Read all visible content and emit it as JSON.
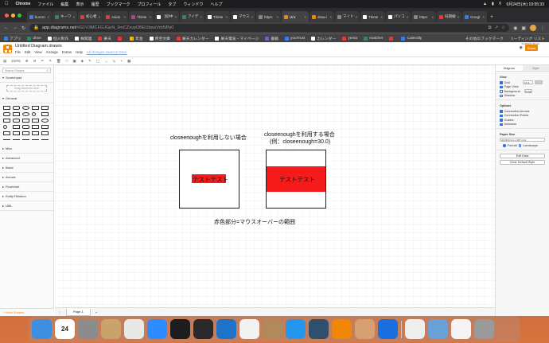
{
  "menubar": {
    "app": "Chrome",
    "items": [
      "ファイル",
      "編集",
      "表示",
      "履歴",
      "ブックマーク",
      "プロフィール",
      "タブ",
      "ウィンドウ",
      "ヘルプ"
    ],
    "datetime": "6月24日(木) 19:55:33"
  },
  "tabs": [
    {
      "label": "kuroro",
      "color": "#3b7de8"
    },
    {
      "label": "キーワ",
      "color": "#2e8b57"
    },
    {
      "label": "初心者",
      "color": "#e53935"
    },
    {
      "label": "Asian",
      "color": "#e53935"
    },
    {
      "label": "Tkinte",
      "color": "#b0438c"
    },
    {
      "label": "【初中",
      "color": "#ffffff"
    },
    {
      "label": "アイデ",
      "color": "#2e8b57"
    },
    {
      "label": "Tkinte",
      "color": "#ffffff"
    },
    {
      "label": "マウス",
      "color": "#ffffff"
    },
    {
      "label": "https:",
      "color": "#888888"
    },
    {
      "label": "Unt",
      "color": "#f08705",
      "active": true
    },
    {
      "label": "draw.i",
      "color": "#f08705"
    },
    {
      "label": "マイド",
      "color": "#888888"
    },
    {
      "label": "Tkinte",
      "color": "#ffffff"
    },
    {
      "label": "パソコ",
      "color": "#ffffff"
    },
    {
      "label": "https:",
      "color": "#888888"
    },
    {
      "label": "同期検",
      "color": "#e53935"
    },
    {
      "label": "Googl",
      "color": "#3b7de8"
    }
  ],
  "address": {
    "url": "app.diagrams.net",
    "url_rest": "/#G1V3MCFGJGpN_9mCZxvpOBEUbwsVrbNPp0"
  },
  "bookmarks": {
    "items": [
      {
        "label": "アプリ",
        "color": "#3b7de8"
      },
      {
        "label": "drive",
        "color": "#2e8b57"
      },
      {
        "label": "個人制作",
        "color": "#ffffff"
      },
      {
        "label": "株関連",
        "color": "#ffffff"
      },
      {
        "label": "楽天",
        "color": "#e53935"
      },
      {
        "label": "",
        "color": "#e53935"
      },
      {
        "label": "年金",
        "color": "#f4b400"
      },
      {
        "label": "青空文庫",
        "color": "#ffffff"
      },
      {
        "label": "楽天カレンダー",
        "color": "#e53935"
      },
      {
        "label": "楽天電気・マイページ",
        "color": "#ffffff"
      },
      {
        "label": "書籍",
        "color": "#8a4fd8"
      },
      {
        "label": "youTrust",
        "color": "#3b7de8"
      },
      {
        "label": "カレンダー",
        "color": "#ffffff"
      },
      {
        "label": "yenta",
        "color": "#e53935"
      },
      {
        "label": "matcher",
        "color": "#2e8b57"
      },
      {
        "label": "",
        "color": "#e53935"
      },
      {
        "label": "Calendly",
        "color": "#3b7de8"
      }
    ],
    "others": "その他のブックマーク",
    "reading_list": "リーディング リスト"
  },
  "drawio": {
    "title": "Untitled Diagram.drawio",
    "menu": [
      "File",
      "Edit",
      "View",
      "Arrange",
      "Extras",
      "Help"
    ],
    "unsaved": "All changes saved in Drive",
    "share": "Share",
    "account": "KURORO BLOG",
    "zoom": "210%",
    "search_placeholder": "Search Shapes",
    "scratchpad": "Scratchpad",
    "drag_hint": "Drag elements here",
    "general": "General",
    "categories": [
      "Misc",
      "Advanced",
      "Basic",
      "Arrows",
      "Flowchart",
      "Entity Relation",
      "UML"
    ],
    "more_shapes": "+ More Shapes...",
    "page_tab": "Page-1"
  },
  "diagram": {
    "label_left": "closeenoughを利用しない場合",
    "label_right_1": "closeenoughを利用する場合",
    "label_right_2": "(例：closeenough=30.0)",
    "box_text_left": "テストテスト",
    "box_text_right": "テストテスト",
    "caption": "赤色部分=マウスオーバーの範囲",
    "highlight_color": "#f51b1b"
  },
  "format_panel": {
    "tabs": [
      "Diagram",
      "Style"
    ],
    "view": "View",
    "grid": "Grid",
    "grid_size": "10 pt",
    "page_view": "Page View",
    "background": "Background",
    "image_btn": "Image",
    "shadow": "Shadow",
    "options": "Options",
    "connection_arrows": "Connection Arrows",
    "connection_points": "Connection Points",
    "guides": "Guides",
    "autosave": "Autosave",
    "paper_size": "Paper Size",
    "paper_value": "A4 (210 mm x 297 mm)",
    "portrait": "Portrait",
    "landscape": "Landscape",
    "edit_data": "Edit Data",
    "clear_default": "Clear Default Style"
  },
  "dock": [
    {
      "name": "finder",
      "color": "#3d8fe0"
    },
    {
      "name": "calendar",
      "color": "#ffffff",
      "text": "24"
    },
    {
      "name": "system-preferences",
      "color": "#8c8c8c"
    },
    {
      "name": "notes",
      "color": "#c9a46a"
    },
    {
      "name": "chrome",
      "color": "#e8e8e8"
    },
    {
      "name": "zoom",
      "color": "#2d8cff"
    },
    {
      "name": "terminal",
      "color": "#1d1d1d"
    },
    {
      "name": "terminal-2",
      "color": "#2a2a2a"
    },
    {
      "name": "vscode",
      "color": "#1e73c8"
    },
    {
      "name": "activity",
      "color": "#f2f2f2"
    },
    {
      "name": "archive",
      "color": "#b08a5a"
    },
    {
      "name": "docker",
      "color": "#2396ed"
    },
    {
      "name": "proxyman",
      "color": "#2f4f6f"
    },
    {
      "name": "drawio",
      "color": "#f08705"
    },
    {
      "name": "preview",
      "color": "#d8a070"
    },
    {
      "name": "infinity",
      "color": "#1a6fe0"
    },
    {
      "name": "textedit",
      "color": "#eeeeee"
    },
    {
      "name": "screenshot",
      "color": "#6aa0d8"
    },
    {
      "name": "document",
      "color": "#f4f4f4"
    },
    {
      "name": "trash",
      "color": "#9a9a9a"
    }
  ]
}
